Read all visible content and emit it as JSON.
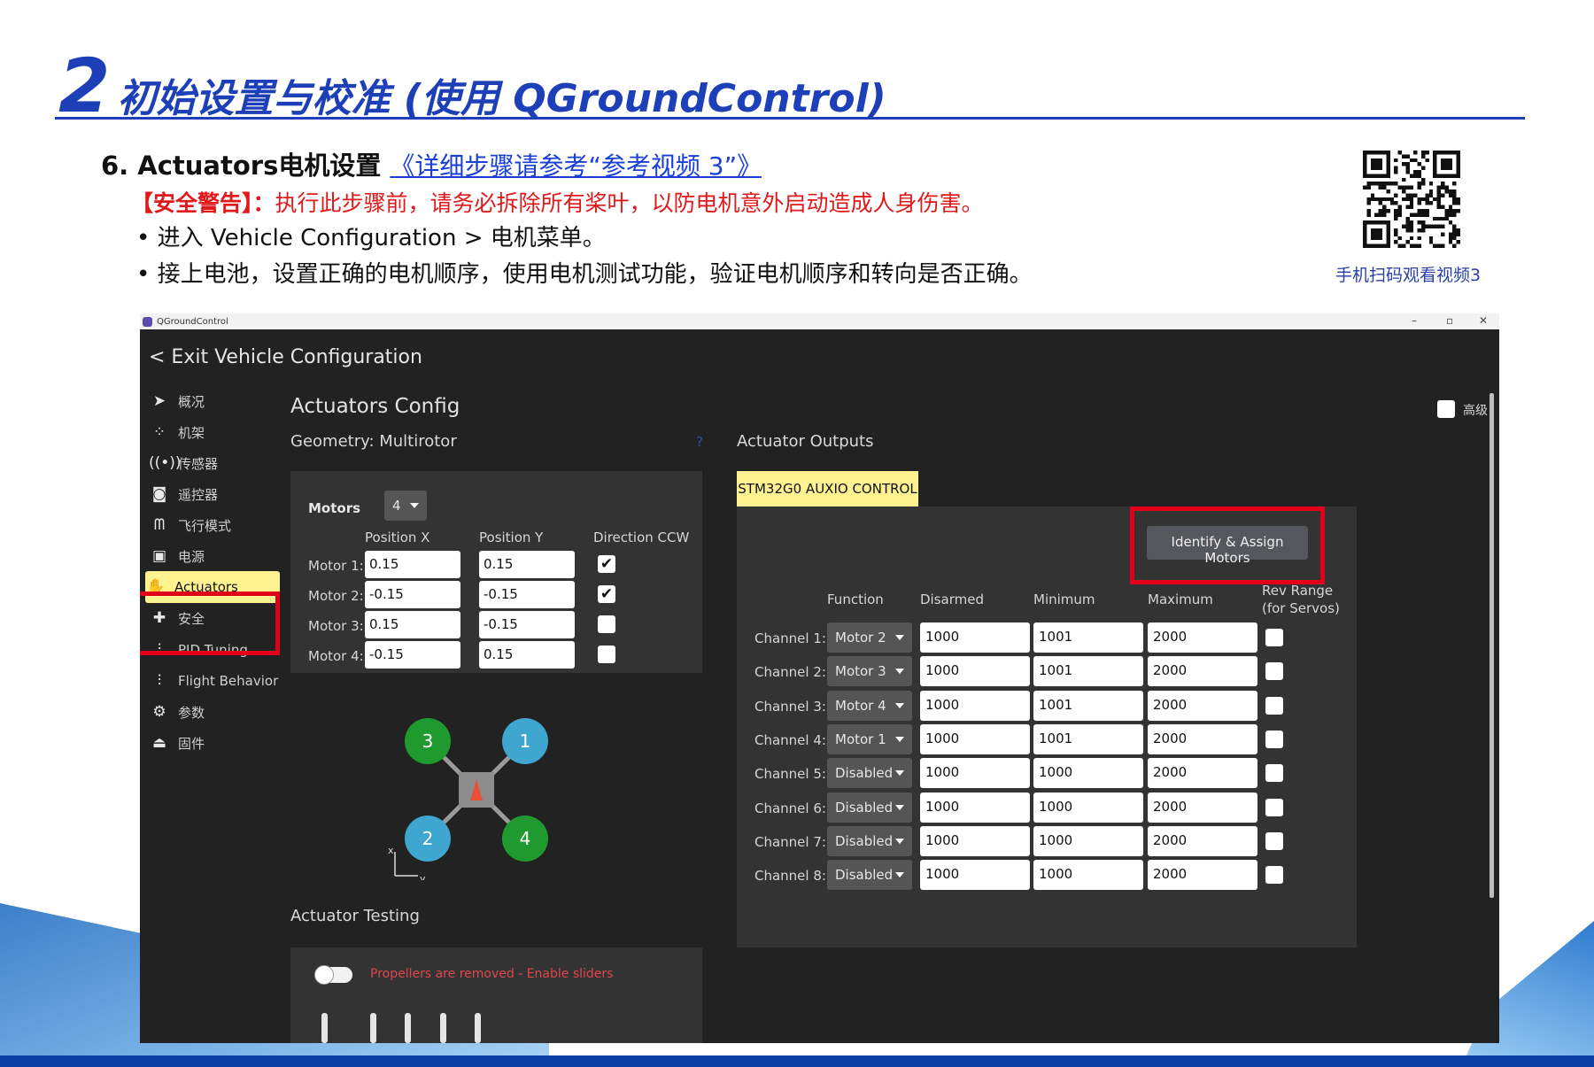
{
  "slide": {
    "title_number": "2",
    "title_text": "初始设置与校准 (使用 QGroundControl)",
    "section_heading": "6. Actuators电机设置",
    "section_link": "《详细步骤请参考“参考视频 3”》",
    "warning_label": "【安全警告】：",
    "warning_text": "执行此步骤前，请务必拆除所有桨叶，以防电机意外启动造成人身伤害。",
    "bullets": [
      "• 进入 Vehicle Configuration > 电机菜单。",
      "• 接上电池，设置正确的电机顺序，使用电机测试功能，验证电机顺序和转向是否正确。"
    ],
    "qr_caption": "手机扫码观看视频3"
  },
  "app": {
    "window_title": "QGroundControl",
    "window_controls": [
      "–",
      "▫",
      "✕"
    ],
    "exit_label": "<  Exit Vehicle Configuration",
    "sidebar": [
      {
        "icon": "paper-plane-icon",
        "glyph": "➤",
        "label": "概况"
      },
      {
        "icon": "airframe-icon",
        "glyph": "⁘",
        "label": "机架"
      },
      {
        "icon": "sensors-icon",
        "glyph": "((•))",
        "label": "传感器"
      },
      {
        "icon": "radio-icon",
        "glyph": "◙",
        "label": "遥控器"
      },
      {
        "icon": "flight-modes-icon",
        "glyph": "ᗰ",
        "label": "飞行模式"
      },
      {
        "icon": "power-icon",
        "glyph": "▣",
        "label": "电源"
      },
      {
        "icon": "actuators-icon",
        "glyph": "✋",
        "label": "Actuators"
      },
      {
        "icon": "safety-icon",
        "glyph": "✚",
        "label": "安全"
      },
      {
        "icon": "pid-tuning-icon",
        "glyph": "⫶",
        "label": "PID Tuning"
      },
      {
        "icon": "flight-behavior-icon",
        "glyph": "⫶",
        "label": "Flight Behavior"
      },
      {
        "icon": "parameters-icon",
        "glyph": "⚙",
        "label": "参数"
      },
      {
        "icon": "firmware-icon",
        "glyph": "⏏",
        "label": "固件"
      }
    ],
    "advanced_label": "高级",
    "actuators_config_title": "Actuators Config",
    "geometry_label": "Geometry: Multirotor",
    "help_glyph": "?",
    "motors_label": "Motors",
    "motors_count": "4",
    "geometry_headers": [
      "Position X",
      "Position Y",
      "Direction CCW"
    ],
    "motors": [
      {
        "label": "Motor 1:",
        "x": "0.15",
        "y": "0.15",
        "ccw": true
      },
      {
        "label": "Motor 2:",
        "x": "-0.15",
        "y": "-0.15",
        "ccw": true
      },
      {
        "label": "Motor 3:",
        "x": "0.15",
        "y": "-0.15",
        "ccw": false
      },
      {
        "label": "Motor 4:",
        "x": "-0.15",
        "y": "0.15",
        "ccw": false
      }
    ],
    "diagram": {
      "motor_labels": [
        "1",
        "2",
        "3",
        "4"
      ],
      "axis_x": "x",
      "axis_y": "y",
      "colors": {
        "ccw": "#3fa6cf",
        "cw": "#1f9a2e",
        "frame": "#9a9a9a",
        "arrow": "#e8503a"
      }
    },
    "actuator_testing_title": "Actuator Testing",
    "propellers_notice": "Propellers are removed - Enable sliders",
    "outputs_title": "Actuator Outputs",
    "output_tab": "STM32G0 AUXIO CONTROL",
    "identify_button": "Identify & Assign Motors",
    "output_headers": {
      "function": "Function",
      "disarmed": "Disarmed",
      "minimum": "Minimum",
      "maximum": "Maximum",
      "rev_range_1": "Rev Range",
      "rev_range_2": "(for Servos)"
    },
    "channels": [
      {
        "label": "Channel 1:",
        "function": "Motor 2",
        "disarmed": "1000",
        "minimum": "1001",
        "maximum": "2000"
      },
      {
        "label": "Channel 2:",
        "function": "Motor 3",
        "disarmed": "1000",
        "minimum": "1001",
        "maximum": "2000"
      },
      {
        "label": "Channel 3:",
        "function": "Motor 4",
        "disarmed": "1000",
        "minimum": "1001",
        "maximum": "2000"
      },
      {
        "label": "Channel 4:",
        "function": "Motor 1",
        "disarmed": "1000",
        "minimum": "1001",
        "maximum": "2000"
      },
      {
        "label": "Channel 5:",
        "function": "Disabled",
        "disarmed": "1000",
        "minimum": "1000",
        "maximum": "2000"
      },
      {
        "label": "Channel 6:",
        "function": "Disabled",
        "disarmed": "1000",
        "minimum": "1000",
        "maximum": "2000"
      },
      {
        "label": "Channel 7:",
        "function": "Disabled",
        "disarmed": "1000",
        "minimum": "1000",
        "maximum": "2000"
      },
      {
        "label": "Channel 8:",
        "function": "Disabled",
        "disarmed": "1000",
        "minimum": "1000",
        "maximum": "2000"
      }
    ],
    "accent_yellow": "#fff291",
    "highlight_red": "#e1001a"
  }
}
